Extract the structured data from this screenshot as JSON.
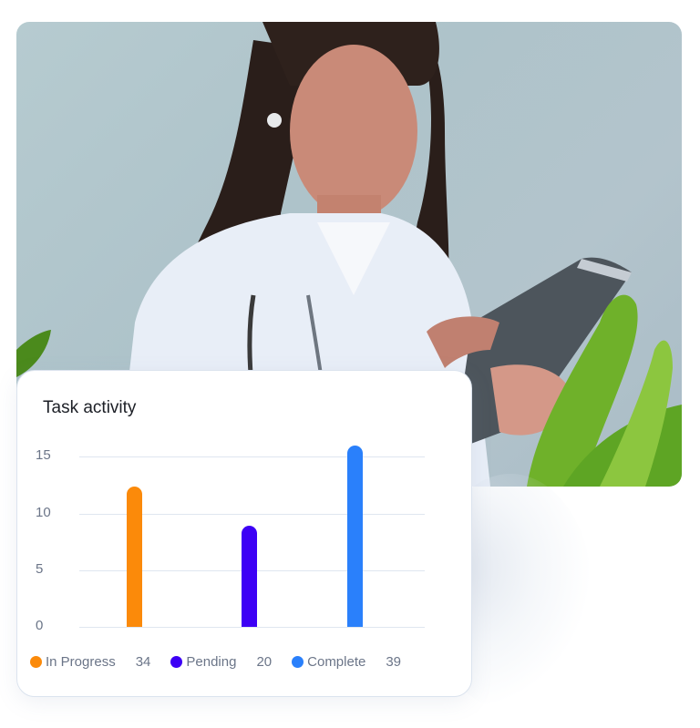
{
  "photo": {
    "description": "Doctor in white coat with stethoscope using a tablet, plant in foreground"
  },
  "card": {
    "title": "Task activity"
  },
  "chart_data": {
    "type": "bar",
    "title": "Task activity",
    "categories": [
      "In Progress",
      "Pending",
      "Complete"
    ],
    "values": [
      12.4,
      8.9,
      16
    ],
    "colors": [
      "#fb8a0a",
      "#3d00f5",
      "#2a80fb"
    ],
    "yticks": [
      "0",
      "5",
      "10",
      "15"
    ],
    "ylim": [
      0,
      16
    ],
    "grid": true,
    "xlabel": "",
    "ylabel": "",
    "legend": {
      "placement": "bottom",
      "items": [
        {
          "label": "In Progress",
          "count": "34",
          "color": "#fb8a0a"
        },
        {
          "label": "Pending",
          "count": "20",
          "color": "#3d00f5"
        },
        {
          "label": "Complete",
          "count": "39",
          "color": "#2a80fb"
        }
      ]
    }
  }
}
